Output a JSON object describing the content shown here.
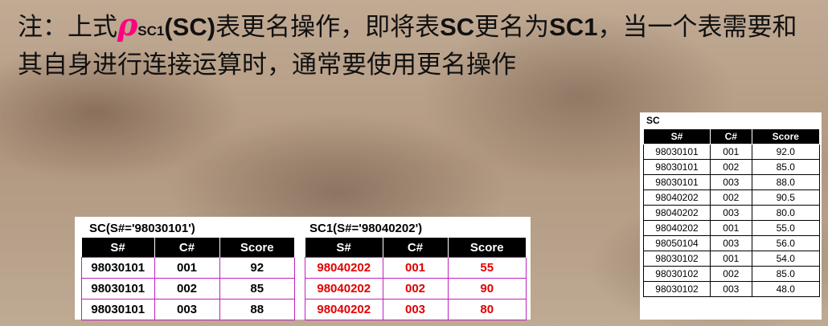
{
  "note": {
    "pre": "注：上式",
    "rho": "ρ",
    "sub": "SC1",
    "sc_paren": "(SC)",
    "t1": "表更名操作，即将表",
    "sc": "SC",
    "t2": "更名为",
    "sc1": "SC1",
    "t3": "，当一个表需要和其自身进行连接运算时，通常要使用更名操作"
  },
  "sc_table": {
    "title": "SC",
    "headers": [
      "S#",
      "C#",
      "Score"
    ],
    "rows": [
      [
        "98030101",
        "001",
        "92.0"
      ],
      [
        "98030101",
        "002",
        "85.0"
      ],
      [
        "98030101",
        "003",
        "88.0"
      ],
      [
        "98040202",
        "002",
        "90.5"
      ],
      [
        "98040202",
        "003",
        "80.0"
      ],
      [
        "98040202",
        "001",
        "55.0"
      ],
      [
        "98050104",
        "003",
        "56.0"
      ],
      [
        "98030102",
        "001",
        "54.0"
      ],
      [
        "98030102",
        "002",
        "85.0"
      ],
      [
        "98030102",
        "003",
        "48.0"
      ]
    ]
  },
  "left_table": {
    "caption": "SC(S#='98030101')",
    "headers": [
      "S#",
      "C#",
      "Score"
    ],
    "rows": [
      [
        "98030101",
        "001",
        "92"
      ],
      [
        "98030101",
        "002",
        "85"
      ],
      [
        "98030101",
        "003",
        "88"
      ]
    ]
  },
  "right_table": {
    "caption": "SC1(S#='98040202')",
    "headers": [
      "S#",
      "C#",
      "Score"
    ],
    "rows": [
      [
        "98040202",
        "001",
        "55"
      ],
      [
        "98040202",
        "002",
        "90"
      ],
      [
        "98040202",
        "003",
        "80"
      ]
    ]
  }
}
